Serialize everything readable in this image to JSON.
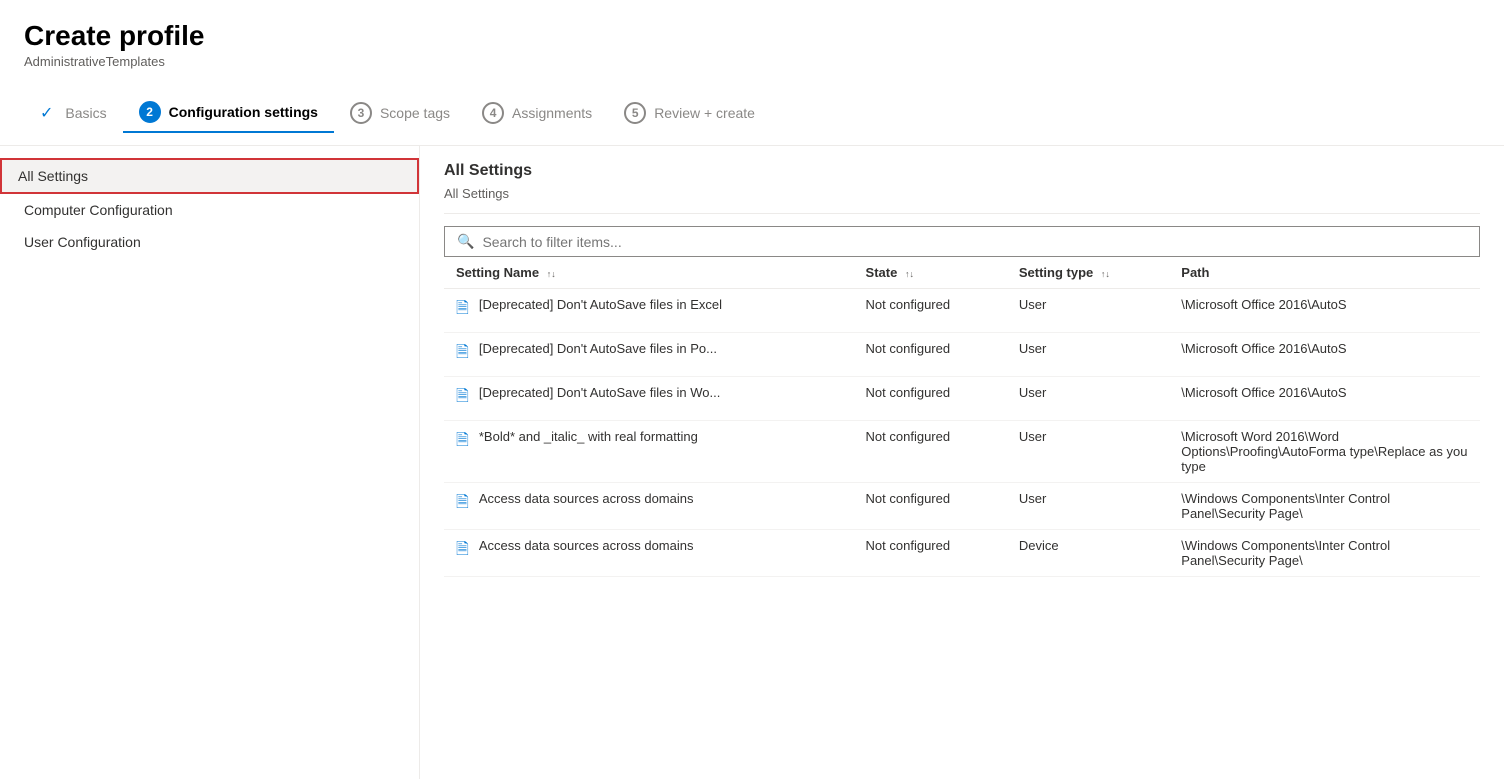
{
  "header": {
    "title": "Create profile",
    "subtitle": "AdministrativeTemplates"
  },
  "wizard": {
    "steps": [
      {
        "id": "basics",
        "number": "✓",
        "label": "Basics",
        "state": "completed"
      },
      {
        "id": "configuration",
        "number": "2",
        "label": "Configuration settings",
        "state": "active"
      },
      {
        "id": "scope",
        "number": "3",
        "label": "Scope tags",
        "state": "inactive"
      },
      {
        "id": "assignments",
        "number": "4",
        "label": "Assignments",
        "state": "inactive"
      },
      {
        "id": "review",
        "number": "5",
        "label": "Review + create",
        "state": "inactive"
      }
    ]
  },
  "sidebar": {
    "items": [
      {
        "id": "all-settings",
        "label": "All Settings",
        "level": "top",
        "selected": true
      },
      {
        "id": "computer-config",
        "label": "Computer Configuration",
        "level": "child",
        "selected": false
      },
      {
        "id": "user-config",
        "label": "User Configuration",
        "level": "child",
        "selected": false
      }
    ]
  },
  "main": {
    "section_title": "All Settings",
    "breadcrumb": "All Settings",
    "search_placeholder": "Search to filter items...",
    "columns": [
      {
        "id": "setting-name",
        "label": "Setting Name"
      },
      {
        "id": "state",
        "label": "State"
      },
      {
        "id": "setting-type",
        "label": "Setting type"
      },
      {
        "id": "path",
        "label": "Path"
      }
    ],
    "rows": [
      {
        "icon": "📄",
        "name": "[Deprecated] Don't AutoSave files in Excel",
        "state": "Not configured",
        "type": "User",
        "path": "\\Microsoft Office 2016\\AutoS"
      },
      {
        "icon": "📄",
        "name": "[Deprecated] Don't AutoSave files in Po...",
        "state": "Not configured",
        "type": "User",
        "path": "\\Microsoft Office 2016\\AutoS"
      },
      {
        "icon": "📄",
        "name": "[Deprecated] Don't AutoSave files in Wo...",
        "state": "Not configured",
        "type": "User",
        "path": "\\Microsoft Office 2016\\AutoS"
      },
      {
        "icon": "📄",
        "name": "*Bold* and _italic_ with real formatting",
        "state": "Not configured",
        "type": "User",
        "path": "\\Microsoft Word 2016\\Word Options\\Proofing\\AutoForma type\\Replace as you type"
      },
      {
        "icon": "📄",
        "name": "Access data sources across domains",
        "state": "Not configured",
        "type": "User",
        "path": "\\Windows Components\\Inter Control Panel\\Security Page\\"
      },
      {
        "icon": "📄",
        "name": "Access data sources across domains",
        "state": "Not configured",
        "type": "Device",
        "path": "\\Windows Components\\Inter Control Panel\\Security Page\\"
      }
    ]
  }
}
